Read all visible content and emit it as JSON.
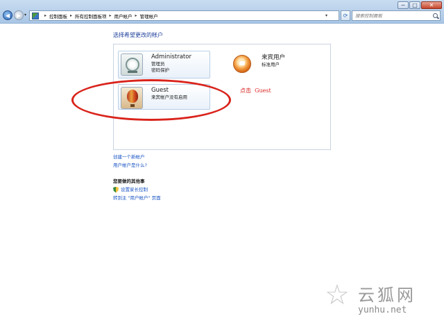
{
  "window": {
    "buttons": {
      "minimize": "─",
      "maximize": "□",
      "close": "✕"
    }
  },
  "nav": {
    "back_icon": "arrow-left-icon",
    "forward_icon": "arrow-right-icon",
    "back_glyph": "◀",
    "forward_glyph": "▶",
    "dropdown_glyph": "▾"
  },
  "address": {
    "separator": "▸",
    "breadcrumbs": [
      "控制面板",
      "所有控制面板项",
      "用户帐户",
      "管理帐户"
    ],
    "dropdown_glyph": "▾",
    "refresh_glyph": "⟳"
  },
  "search": {
    "placeholder": "搜索控制面板",
    "value": ""
  },
  "page_title": "选择希望更改的帐户",
  "accounts": [
    {
      "name": "Administrator",
      "lines": [
        "管理员",
        "密码保护"
      ],
      "icon": "satellite-dish-avatar-icon"
    },
    {
      "name": "来宾用户",
      "lines": [
        "标准用户"
      ],
      "icon": "orange-user-avatar-icon"
    },
    {
      "name": "Guest",
      "lines": [
        "来宾帐户没有启用"
      ],
      "icon": "hot-air-balloon-avatar-icon"
    }
  ],
  "annotation": {
    "text": "点击  Guest",
    "color": "#d8231f"
  },
  "links": [
    "创建一个新帐户",
    "用户帐户是什么?"
  ],
  "related": {
    "heading": "您要做的其他事",
    "items": [
      {
        "label": "设置家长控制",
        "icon": "shield-icon"
      },
      {
        "label": "转到主 \"用户帐户\" 页面",
        "icon": ""
      }
    ]
  },
  "watermark": {
    "chinese": "云狐网",
    "url": "yunhu.net"
  },
  "colors": {
    "link": "#1a55c4",
    "title": "#1e3f9a",
    "highlight": "#d9231b"
  }
}
